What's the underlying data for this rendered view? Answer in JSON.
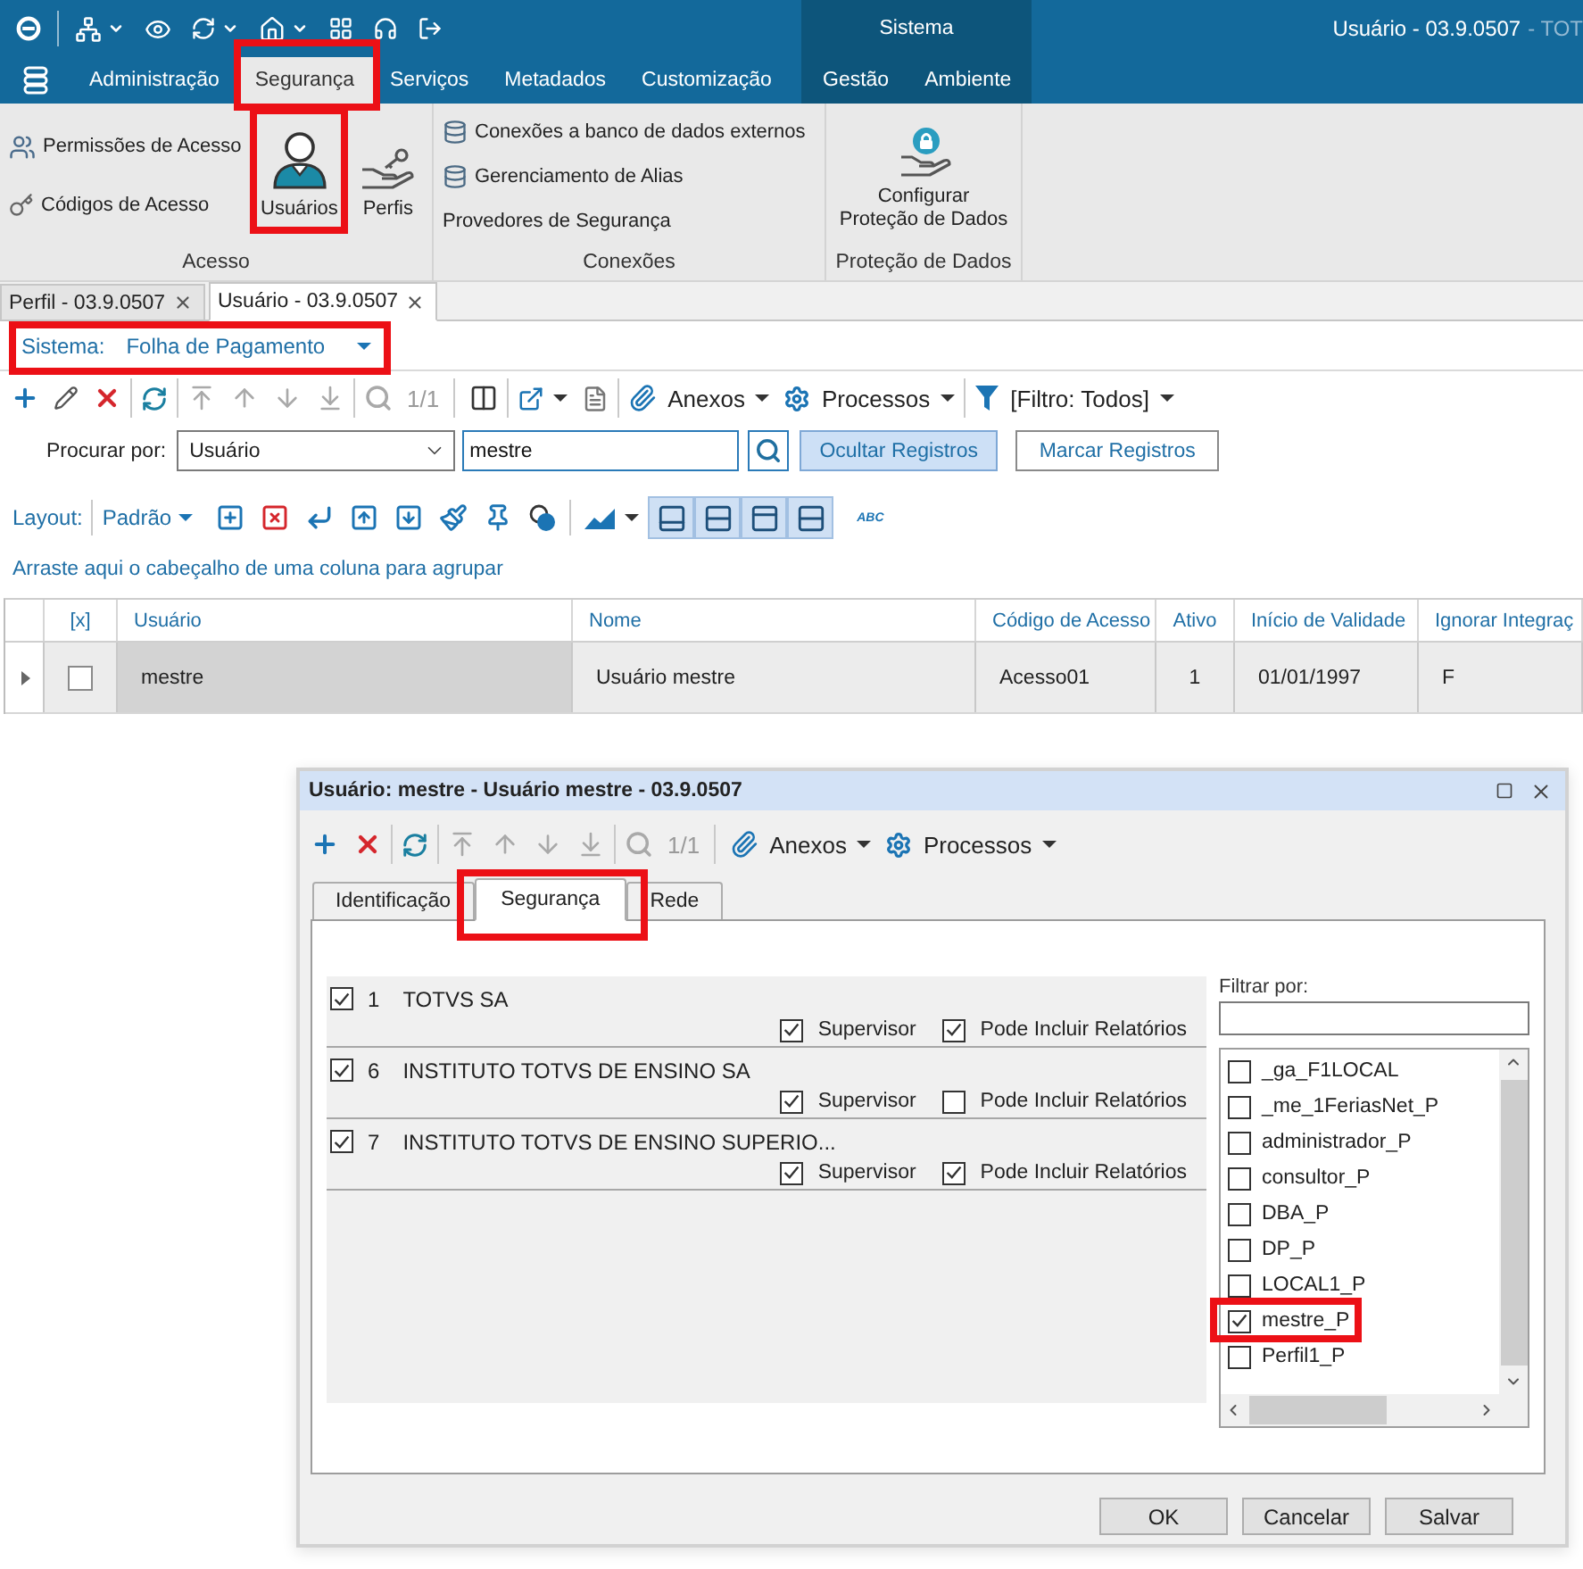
{
  "window": {
    "context_title": "Sistema",
    "title": "Usuário - 03.9.0507",
    "title_suffix": "- TOT"
  },
  "menu": {
    "tabs": [
      {
        "label": "Administração",
        "kind": "standard",
        "selected": false,
        "highlighted": false
      },
      {
        "label": "Segurança",
        "kind": "standard",
        "selected": true,
        "highlighted": true
      },
      {
        "label": "Serviços",
        "kind": "standard",
        "selected": false,
        "highlighted": false
      },
      {
        "label": "Metadados",
        "kind": "standard",
        "selected": false,
        "highlighted": false
      },
      {
        "label": "Customização",
        "kind": "standard",
        "selected": false,
        "highlighted": false
      },
      {
        "label": "Gestão",
        "kind": "context",
        "selected": false,
        "highlighted": false
      },
      {
        "label": "Ambiente",
        "kind": "context",
        "selected": false,
        "highlighted": false
      }
    ]
  },
  "ribbon": {
    "groups": [
      {
        "label": "Acesso",
        "small_items": [
          "Permissões de Acesso",
          "Códigos de Acesso"
        ],
        "large_items": [
          {
            "label": "Usuários",
            "highlighted": true
          },
          {
            "label": "Perfis",
            "highlighted": false
          }
        ]
      },
      {
        "label": "Conexões",
        "small_items": [
          "Conexões a banco de dados externos",
          "Gerenciamento de Alias",
          "Provedores de Segurança"
        ]
      },
      {
        "label": "Proteção de Dados",
        "large_items": [
          {
            "label": "Configurar Proteção de Dados",
            "highlighted": false
          }
        ]
      }
    ]
  },
  "documents": {
    "tabs": [
      {
        "label": "Perfil - 03.9.0507",
        "selected": false
      },
      {
        "label": "Usuário - 03.9.0507",
        "selected": true
      }
    ]
  },
  "system_selector": {
    "label": "Sistema:",
    "value": "Folha de Pagamento",
    "highlighted": true
  },
  "toolbar": {
    "counter": "1/1",
    "attachments": "Anexos",
    "processes": "Processos",
    "filter": "[Filtro: Todos]"
  },
  "search": {
    "label": "Procurar por:",
    "field": "Usuário",
    "value": "mestre",
    "buttons": [
      {
        "label": "Ocultar Registros",
        "selected": true
      },
      {
        "label": "Marcar Registros",
        "selected": false
      }
    ]
  },
  "layout_bar": {
    "label": "Layout:",
    "preset": "Padrão",
    "toggles": [
      {
        "selected": true
      },
      {
        "selected": true
      },
      {
        "selected": true
      },
      {
        "selected": true
      }
    ],
    "text_tool": "ABC"
  },
  "grid": {
    "group_hint": "Arraste aqui o cabeçalho de uma coluna para agrupar",
    "check_column": "[x]",
    "columns": [
      "Usuário",
      "Nome",
      "Código de Acesso",
      "Ativo",
      "Início de Validade",
      "Ignorar Integraç"
    ],
    "rows": [
      {
        "selected": true,
        "checked": false,
        "cells": [
          "mestre",
          "Usuário mestre",
          "Acesso01",
          "1",
          "01/01/1997",
          "F"
        ]
      }
    ]
  },
  "dialog": {
    "title": "Usuário: mestre - Usuário mestre - 03.9.0507",
    "toolbar": {
      "counter": "1/1",
      "attachments": "Anexos",
      "processes": "Processos"
    },
    "tabs": [
      {
        "label": "Identificação",
        "selected": false,
        "highlighted": false
      },
      {
        "label": "Segurança",
        "selected": true,
        "highlighted": true
      },
      {
        "label": "Rede",
        "selected": false,
        "highlighted": false
      }
    ],
    "companies": [
      {
        "checked": true,
        "code": "1",
        "name": "TOTVS SA",
        "options": [
          {
            "label": "Supervisor",
            "checked": true
          },
          {
            "label": "Pode Incluir Relatórios",
            "checked": true
          }
        ]
      },
      {
        "checked": true,
        "code": "6",
        "name": "INSTITUTO TOTVS DE ENSINO SA",
        "options": [
          {
            "label": "Supervisor",
            "checked": true
          },
          {
            "label": "Pode Incluir Relatórios",
            "checked": false
          }
        ]
      },
      {
        "checked": true,
        "code": "7",
        "name": "INSTITUTO TOTVS DE ENSINO SUPERIO...",
        "options": [
          {
            "label": "Supervisor",
            "checked": true
          },
          {
            "label": "Pode Incluir Relatórios",
            "checked": true
          }
        ]
      }
    ],
    "filter": {
      "label": "Filtrar por:"
    },
    "profiles": [
      {
        "label": "_ga_F1LOCAL",
        "checked": false,
        "highlighted": false
      },
      {
        "label": "_me_1FeriasNet_P",
        "checked": false,
        "highlighted": false
      },
      {
        "label": "administrador_P",
        "checked": false,
        "highlighted": false
      },
      {
        "label": "consultor_P",
        "checked": false,
        "highlighted": false
      },
      {
        "label": "DBA_P",
        "checked": false,
        "highlighted": false
      },
      {
        "label": "DP_P",
        "checked": false,
        "highlighted": false
      },
      {
        "label": "LOCAL1_P",
        "checked": false,
        "highlighted": false
      },
      {
        "label": "mestre_P",
        "checked": true,
        "highlighted": true
      },
      {
        "label": "Perfil1_P",
        "checked": false,
        "highlighted": false
      }
    ],
    "buttons": [
      "OK",
      "Cancelar",
      "Salvar"
    ]
  }
}
